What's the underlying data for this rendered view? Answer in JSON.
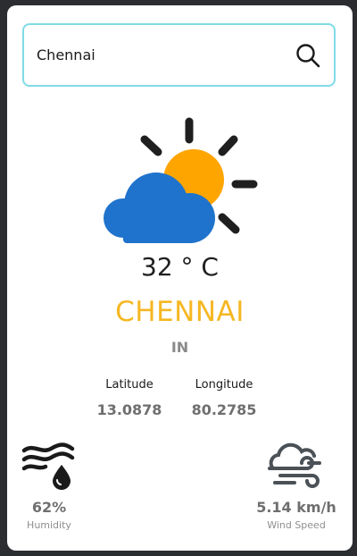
{
  "search": {
    "value": "Chennai",
    "icon": "search-icon"
  },
  "weather": {
    "icon": "partly-cloudy-icon",
    "temperature": "32 ° C",
    "city": "CHENNAI",
    "country": "IN",
    "colors": {
      "sun": "#ffa500",
      "cloud": "#1f73cc",
      "city_text": "#f5b722",
      "search_border": "#7fdbe6"
    }
  },
  "coordinates": {
    "latitude_label": "Latitude",
    "latitude_value": "13.0878",
    "longitude_label": "Longitude",
    "longitude_value": "80.2785"
  },
  "stats": {
    "humidity_value": "62%",
    "humidity_label": "Humidity",
    "humidity_icon": "humidity-icon",
    "wind_value": "5.14 km/h",
    "wind_label": "Wind Speed",
    "wind_icon": "wind-icon"
  }
}
